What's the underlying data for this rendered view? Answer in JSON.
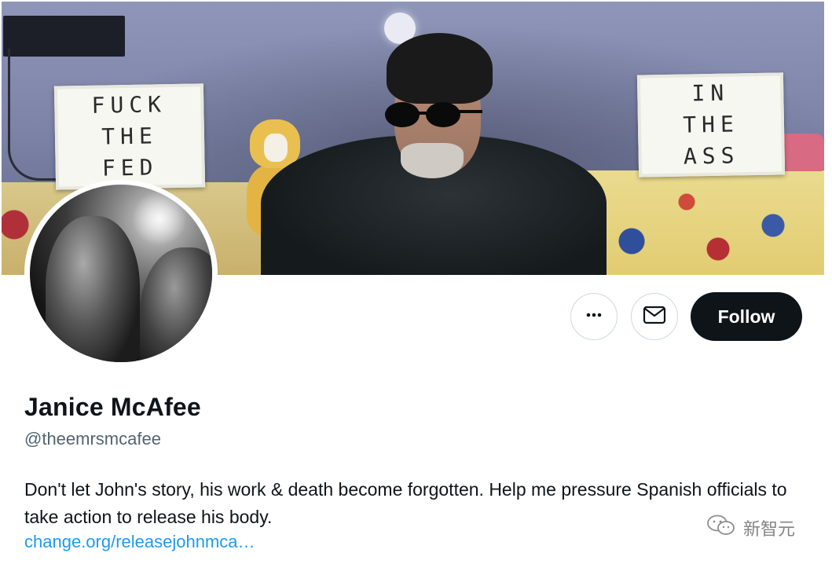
{
  "banner": {
    "sign_left": [
      "FUCK",
      "THE",
      "FED"
    ],
    "sign_right": [
      "IN",
      "THE",
      "ASS"
    ]
  },
  "actions": {
    "more_icon": "more-horizontal-icon",
    "message_icon": "mail-envelope-icon",
    "follow_label": "Follow"
  },
  "profile": {
    "display_name": "Janice McAfee",
    "handle": "@theemrsmcafee",
    "bio": "Don't let John's story, his work & death become forgotten. Help me pressure Spanish officials to take action to release his body.",
    "link": "change.org/releasejohnmca…"
  },
  "watermark": {
    "text": "新智元",
    "icon": "wechat-icon"
  },
  "colors": {
    "follow_bg": "#0f1419",
    "handle": "#536471",
    "link": "#1d9bf0",
    "border": "#cfd9de"
  }
}
